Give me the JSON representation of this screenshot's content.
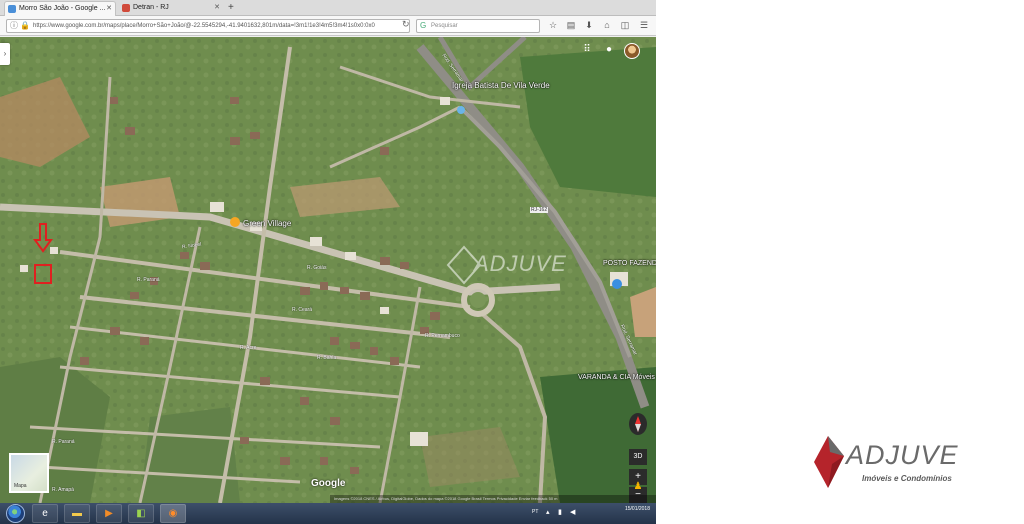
{
  "browser": {
    "tabs": [
      {
        "label": "Morro São João - Google ...",
        "favicon_color": "#4a8fd8",
        "active": true
      },
      {
        "label": "Detran - RJ",
        "favicon_color": "#d04a3a",
        "active": false
      }
    ],
    "new_tab_label": "+",
    "url": "https://www.google.com.br/maps/place/Morro+São+João/@-22.5545294,-41.9401632,801m/data=!3m1!1e3!4m5!3m4!1s0x0:0x0",
    "search_placeholder": "Pesquisar",
    "toolbar_icons": [
      "star-icon",
      "reading-list-icon",
      "download-icon",
      "home-icon",
      "menu-icon"
    ]
  },
  "map": {
    "labels": {
      "church": "Igreja Batista De Vila Verde",
      "village": "Green Village",
      "gas_station": "POSTO FAZENDA BOA VENDA",
      "furniture": "VARANDA & CIA Móveis Para Varanda",
      "road_tag": "RJ-162"
    },
    "streets": [
      "R. Nobel",
      "R. Paraná",
      "R. Goiás",
      "R. Ceará",
      "R. Acre",
      "R. Bahia",
      "R. Pernambuco",
      "R. Paraná",
      "R. Amapá",
      "Rod. Serramar",
      "Rod. Serramar"
    ],
    "google_logo": "Google",
    "attribution": "Imagens ©2018 CNES / Airbus, DigitalGlobe, Dados do mapa ©2018 Google   Brasil   Termos   Privacidade   Enviar feedback   50 m",
    "minimap_label": "Mapa",
    "controls": {
      "tilt": "3D",
      "zoom_in": "+",
      "zoom_out": "−"
    },
    "watermark": "ADJUVE"
  },
  "taskbar": {
    "lang": "PT",
    "time": "",
    "date": "15/01/2018"
  },
  "logo": {
    "name": "ADJUVE",
    "tagline": "Imóveis e Condomínios",
    "accent_color": "#b5242b"
  }
}
